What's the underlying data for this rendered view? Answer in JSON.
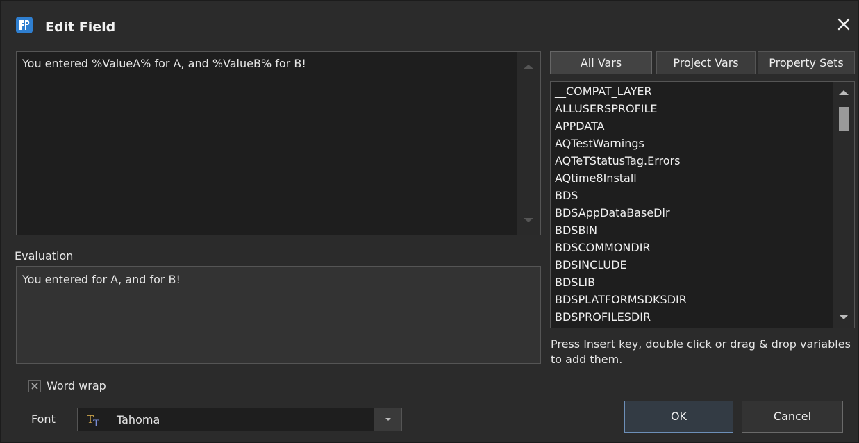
{
  "window": {
    "title": "Edit Field",
    "app_icon": "app-logo-icon",
    "close_icon": "close-icon"
  },
  "editor": {
    "text": "You entered %ValueA% for A, and %ValueB% for B!"
  },
  "evaluation": {
    "label": "Evaluation",
    "text": "You entered  for A, and  for B!"
  },
  "options": {
    "word_wrap_label": "Word wrap",
    "word_wrap_checked": true
  },
  "font": {
    "label": "Font",
    "value": "Tahoma",
    "icon": "truetype-font-icon"
  },
  "tabs": [
    {
      "label": "All Vars",
      "active": true
    },
    {
      "label": "Project Vars",
      "active": false
    },
    {
      "label": "Property Sets",
      "active": false
    }
  ],
  "variables": [
    "__COMPAT_LAYER",
    "ALLUSERSPROFILE",
    "APPDATA",
    "AQTestWarnings",
    "AQTeTStatusTag.Errors",
    "AQtime8Install",
    "BDS",
    "BDSAppDataBaseDir",
    "BDSBIN",
    "BDSCOMMONDIR",
    "BDSINCLUDE",
    "BDSLIB",
    "BDSPLATFORMSDKSDIR",
    "BDSPROFILESDIR"
  ],
  "hint": "Press Insert key, double click or drag & drop variables to add them.",
  "buttons": {
    "ok": "OK",
    "cancel": "Cancel"
  },
  "colors": {
    "background": "#2b2b2b",
    "input_bg": "#1e1e1e",
    "accent": "#2f7fd0"
  }
}
